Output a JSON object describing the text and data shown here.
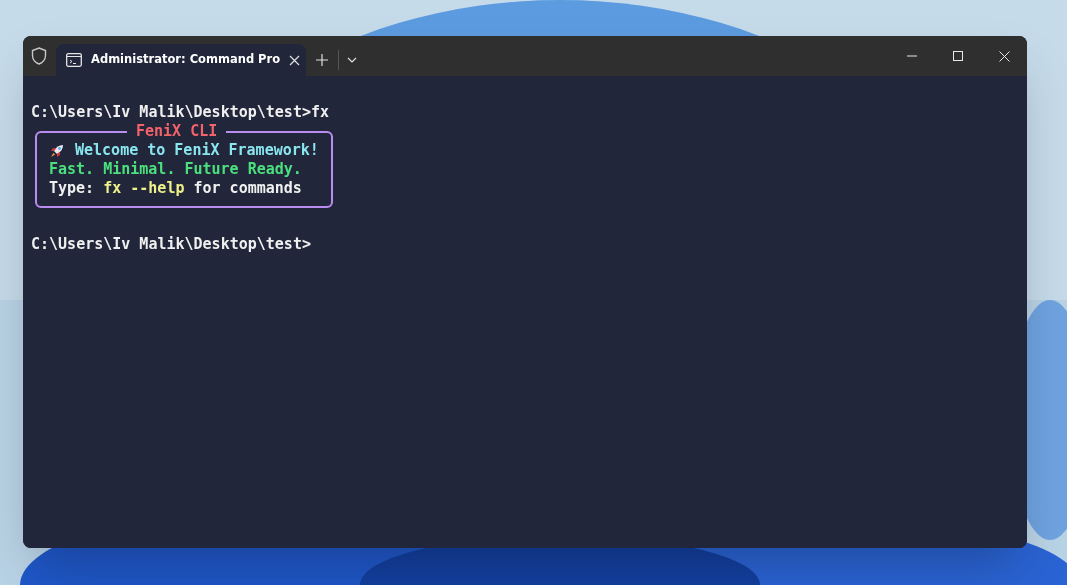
{
  "tab": {
    "title": "Administrator: Command Pro",
    "selected": true
  },
  "terminal": {
    "command_line": "C:\\Users\\Iv Malik\\Desktop\\test>fx",
    "banner": {
      "title": "FeniX CLI",
      "lines": [
        {
          "segments": [
            {
              "kind": "accent",
              "text": "Welcome to FeniX Framework!"
            }
          ],
          "rocket": true
        },
        {
          "segments": [
            {
              "kind": "success",
              "text": "Fast. Minimal. Future Ready."
            }
          ],
          "rocket": false
        },
        {
          "segments": [
            {
              "kind": "plain",
              "text": "Type: "
            },
            {
              "kind": "highlight",
              "text": "fx --help"
            },
            {
              "kind": "plain",
              "text": " for commands"
            }
          ],
          "rocket": false
        }
      ]
    },
    "prompt": "C:\\Users\\Iv Malik\\Desktop\\test>"
  }
}
